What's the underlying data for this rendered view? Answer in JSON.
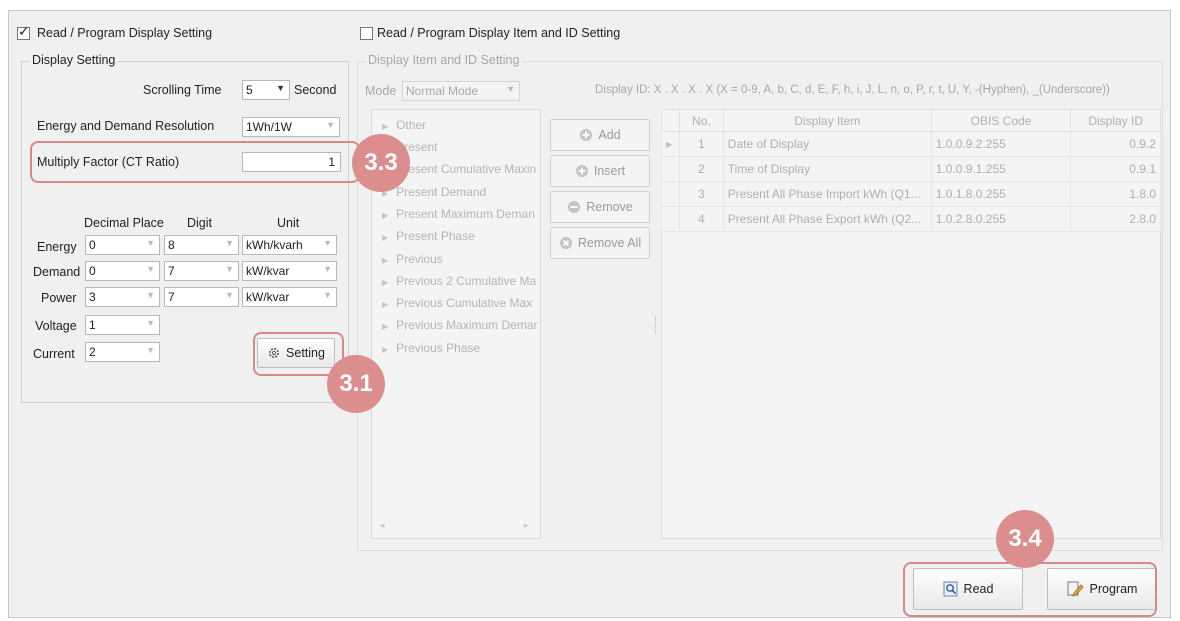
{
  "left": {
    "checkbox_label": "Read / Program Display Setting",
    "group_title": "Display Setting",
    "scrolling_time_label": "Scrolling Time",
    "scrolling_time_value": "5",
    "scrolling_time_unit": "Second",
    "resolution_label": "Energy and Demand Resolution",
    "resolution_value": "1Wh/1W",
    "multiply_label": "Multiply Factor (CT Ratio)",
    "multiply_value": "1",
    "col_decimal": "Decimal Place",
    "col_digit": "Digit",
    "col_unit": "Unit",
    "rows": [
      {
        "label": "Energy",
        "decimal": "0",
        "digit": "8",
        "unit": "kWh/kvarh"
      },
      {
        "label": "Demand",
        "decimal": "0",
        "digit": "7",
        "unit": "kW/kvar"
      },
      {
        "label": "Power",
        "decimal": "3",
        "digit": "7",
        "unit": "kW/kvar"
      },
      {
        "label": "Voltage",
        "decimal": "1"
      },
      {
        "label": "Current",
        "decimal": "2"
      }
    ],
    "setting_button": "Setting"
  },
  "right": {
    "checkbox_label": "Read / Program Display Item and ID Setting",
    "group_title": "Display Item and ID Setting",
    "mode_label": "Mode",
    "mode_value": "Normal Mode",
    "display_id_hint": "Display ID: X . X . X . X  (X = 0-9, A, b, C, d, E, F, h, i, J, L, n, o, P, r, t, U, Y, -(Hyphen), _(Underscore))",
    "tree_items": [
      "Other",
      "Present",
      "Present Cumulative Maxin",
      "Present Demand",
      "Present Maximum Deman",
      "Present Phase",
      "Previous",
      "Previous 2 Cumulative Ma",
      "Previous Cumulative Max",
      "Previous Maximum Demar",
      "Previous Phase"
    ],
    "buttons": {
      "add": "Add",
      "insert": "Insert",
      "remove": "Remove",
      "remove_all": "Remove All"
    },
    "table": {
      "headers": [
        "No.",
        "Display Item",
        "OBIS Code",
        "Display ID"
      ],
      "rows": [
        {
          "no": "1",
          "item": "Date of Display",
          "obis": "1.0.0.9.2.255",
          "id": "0.9.2"
        },
        {
          "no": "2",
          "item": "Time of Display",
          "obis": "1.0.0.9.1.255",
          "id": "0.9.1"
        },
        {
          "no": "3",
          "item": "Present All Phase Import kWh (Q1...",
          "obis": "1.0.1.8.0.255",
          "id": "1.8.0"
        },
        {
          "no": "4",
          "item": "Present All Phase Export kWh (Q2...",
          "obis": "1.0.2.8.0.255",
          "id": "2.8.0"
        }
      ]
    }
  },
  "bottom": {
    "read_button": "Read",
    "program_button": "Program"
  },
  "callouts": {
    "c31": "3.1",
    "c33": "3.3",
    "c34": "3.4"
  },
  "colors": {
    "callout": "#dc8e8e",
    "highlight_border": "#d9888a"
  }
}
